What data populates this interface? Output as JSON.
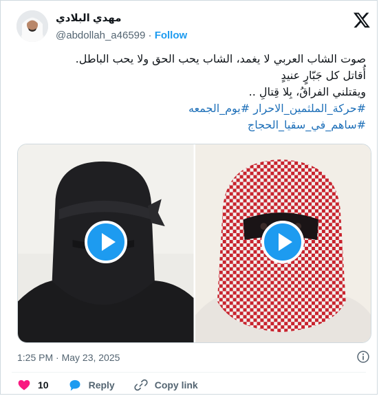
{
  "author": {
    "display_name": "مهدي البلادي",
    "handle": "@abdollah_a46599",
    "separator": "·",
    "follow_label": "Follow"
  },
  "tweet": {
    "lines": [
      "صوت الشاب العربي لا يغمد، الشاب يحب الحق ولا يحب الباطل.",
      "أُقاتل كل جَبّارٍ عنيدٍ",
      "ويقتلني الفراقُ، بِلا قِتالِ .."
    ],
    "hashtag_line_1": [
      "#حركة_الملثمين_الاحرار",
      "#يوم_الجمعه"
    ],
    "hashtag_line_2": [
      "#ساهم_في_سقيا_الحجاج"
    ]
  },
  "media": {
    "videos": [
      {
        "name": "video-1",
        "icon": "play-icon"
      },
      {
        "name": "video-2",
        "icon": "play-icon"
      }
    ]
  },
  "timestamp": "1:25 PM · May 23, 2025",
  "actions": {
    "like_count": "10",
    "reply_label": "Reply",
    "copy_label": "Copy link"
  },
  "colors": {
    "accent": "#1d9bf0",
    "like": "#f91880",
    "hashtag": "#1d6fb8",
    "text": "#0f1419",
    "muted": "#536471"
  }
}
